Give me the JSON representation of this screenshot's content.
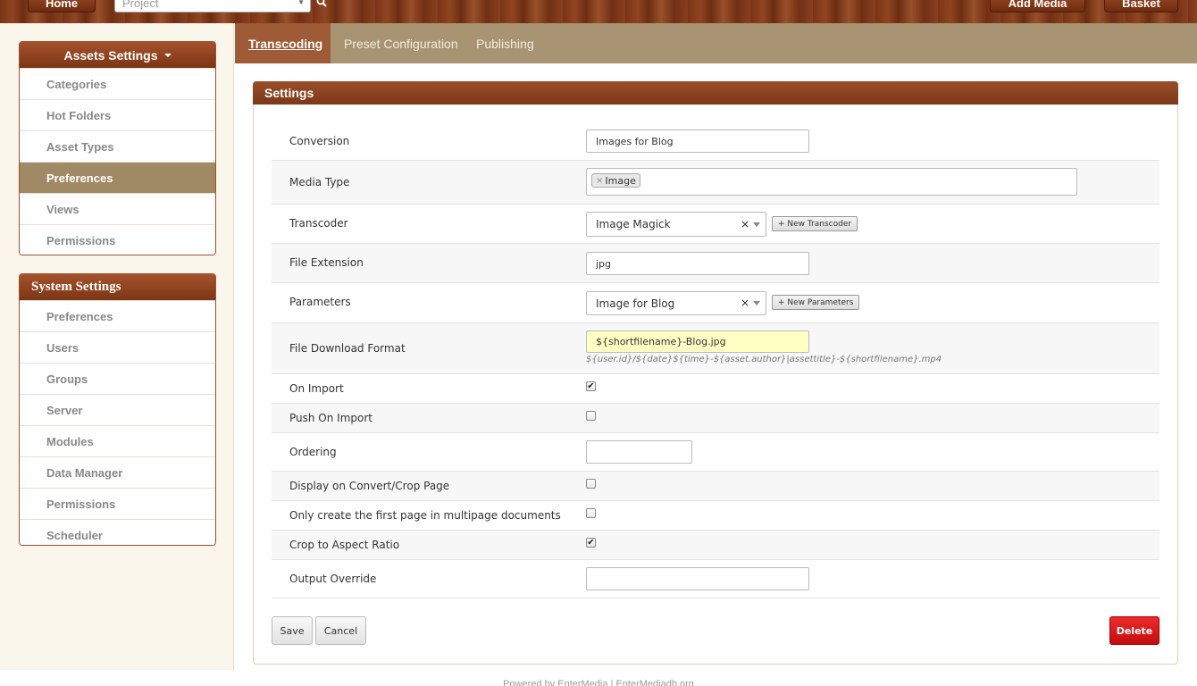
{
  "header": {
    "home_label": "Home",
    "search_placeholder": "Project",
    "add_media_label": "Add Media",
    "basket_label": "Basket"
  },
  "sidebar": {
    "assets_title": "Assets Settings",
    "assets_items": [
      "Categories",
      "Hot Folders",
      "Asset Types",
      "Preferences",
      "Views",
      "Permissions"
    ],
    "system_title": "System Settings",
    "system_items": [
      "Preferences",
      "Users",
      "Groups",
      "Server",
      "Modules",
      "Data Manager",
      "Permissions",
      "Scheduler"
    ]
  },
  "tabs": [
    "Transcoding",
    "Preset Configuration",
    "Publishing"
  ],
  "settings": {
    "title": "Settings",
    "conversion_label": "Conversion",
    "conversion_value": "Images for Blog",
    "media_type_label": "Media Type",
    "media_type_tag": "Image",
    "transcoder_label": "Transcoder",
    "transcoder_value": "Image Magick",
    "new_transcoder_label": "+ New Transcoder",
    "file_extension_label": "File Extension",
    "file_extension_value": "jpg",
    "parameters_label": "Parameters",
    "parameters_value": "Image for Blog",
    "new_parameters_label": "+ New Parameters",
    "file_download_label": "File Download Format",
    "file_download_value": "${shortfilename}-Blog.jpg",
    "file_download_hint": "${user.id}/${date}${time}-${asset.author}|assettitle}-${shortfilename}.mp4",
    "on_import_label": "On Import",
    "on_import_checked": true,
    "push_on_import_label": "Push On Import",
    "push_on_import_checked": false,
    "ordering_label": "Ordering",
    "ordering_value": "",
    "display_convert_label": "Display on Convert/Crop Page",
    "display_convert_checked": false,
    "first_page_label": "Only create the first page in multipage documents",
    "first_page_checked": false,
    "crop_aspect_label": "Crop to Aspect Ratio",
    "crop_aspect_checked": true,
    "output_override_label": "Output Override",
    "output_override_value": ""
  },
  "actions": {
    "save_label": "Save",
    "cancel_label": "Cancel",
    "delete_label": "Delete"
  },
  "footer": {
    "text": "Powered by EnterMedia | EnterMediadb.org"
  },
  "colors": {
    "brand_brown": "#8a4320",
    "tab_bar": "#a89472",
    "active_nav": "#a08a65",
    "delete_red": "#e01818"
  }
}
